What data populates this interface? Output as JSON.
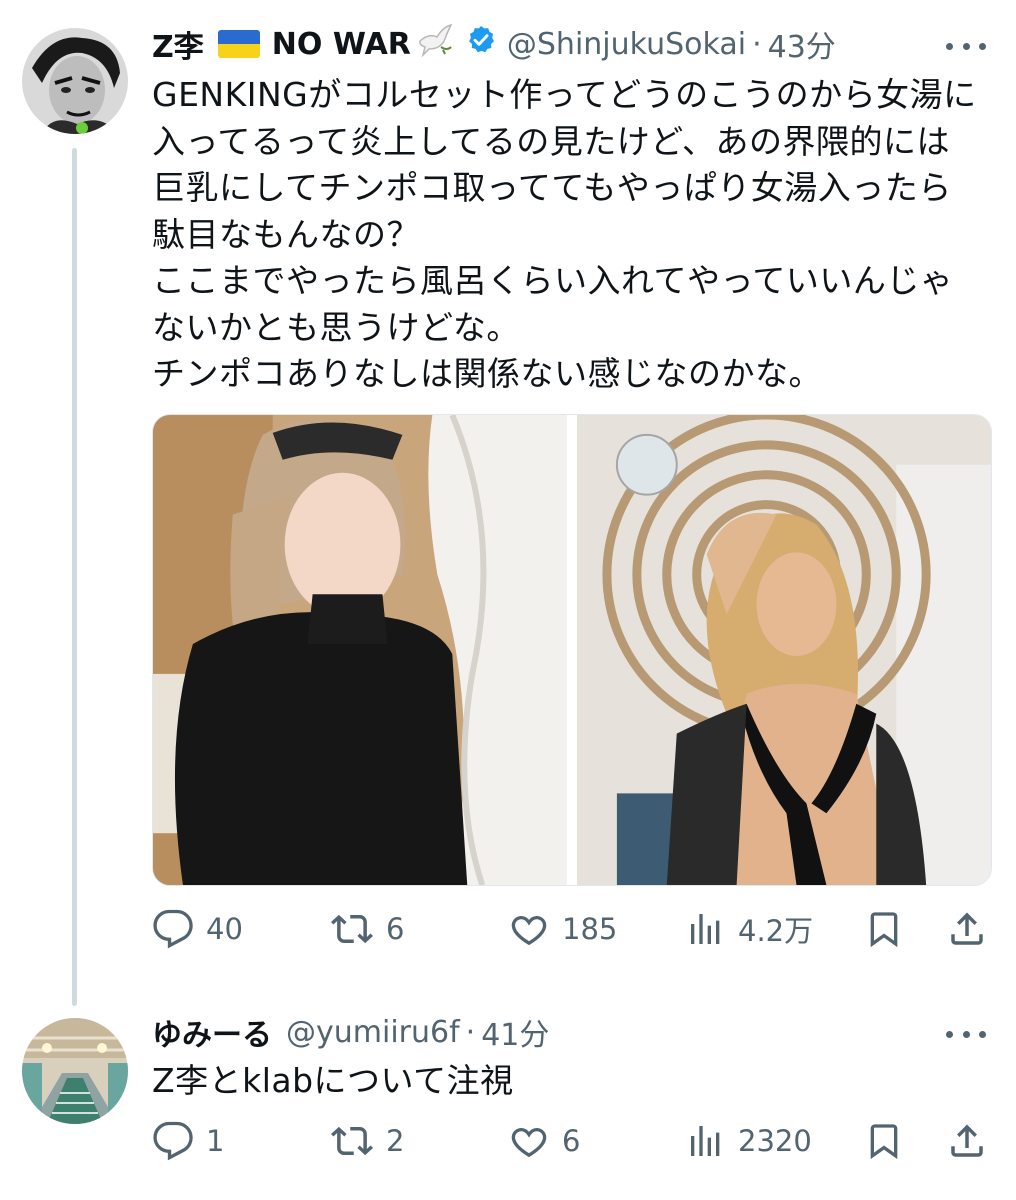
{
  "tweet1": {
    "display_name": "Z李",
    "nowar_label": "NO WAR",
    "handle": "@ShinjukuSokai",
    "time": "43分",
    "text": "GENKINGがコルセット作ってどうのこうのから女湯に\n入ってるって炎上してるの見たけど、あの界隈的には\n巨乳にしてチンポコ取っててもやっぱり女湯入ったら\n駄目なもんなの？\nここまでやったら風呂くらい入れてやっていいんじゃ\nないかとも思うけどな。\nチンポコありなしは関係ない感じなのかな。",
    "replies": "40",
    "retweets": "6",
    "likes": "185",
    "views": "4.2万"
  },
  "tweet2": {
    "display_name": "ゆみーる",
    "handle": "@yumiiru6f",
    "time": "41分",
    "text": "Z李とklabについて注視",
    "replies": "1",
    "retweets": "2",
    "likes": "6",
    "views": "2320"
  },
  "colors": {
    "text": "#0f1419",
    "secondary": "#536471",
    "verified": "#1d9bf0",
    "thread_line": "#cfd9de"
  },
  "icons": [
    "reply-icon",
    "retweet-icon",
    "like-icon",
    "views-icon",
    "bookmark-icon",
    "share-icon",
    "verified-icon",
    "more-icon",
    "dove-icon",
    "ukraine-flag-icon"
  ]
}
